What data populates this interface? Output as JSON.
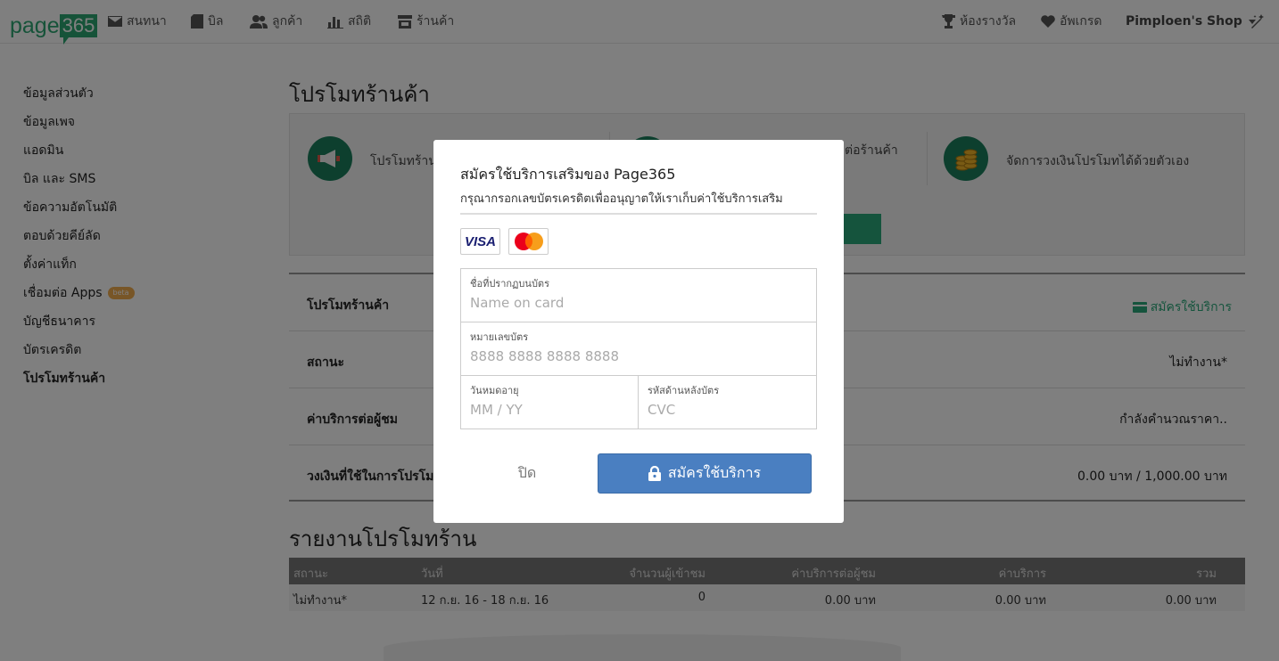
{
  "topnav": {
    "logo_text": "page",
    "logo_num": "365",
    "items": [
      {
        "label": "สนทนา",
        "icon": "envelope-icon"
      },
      {
        "label": "บิล",
        "icon": "bill-icon"
      },
      {
        "label": "ลูกค้า",
        "icon": "users-icon"
      },
      {
        "label": "สถิติ",
        "icon": "bar-chart-icon"
      },
      {
        "label": "ร้านค้า",
        "icon": "store-icon"
      }
    ],
    "right": [
      {
        "label": "ห้องรางวัล",
        "icon": "trophy-icon"
      },
      {
        "label": "อัพเกรด",
        "icon": "heart-icon"
      }
    ],
    "shop_name": "Pimploen's Shop"
  },
  "sidebar": {
    "items": [
      {
        "label": "ข้อมูลส่วนตัว"
      },
      {
        "label": "ข้อมูลเพจ"
      },
      {
        "label": "แอดมิน"
      },
      {
        "label": "บิล และ SMS"
      },
      {
        "label": "ข้อความอัตโนมัติ"
      },
      {
        "label": "ตอบด้วยคีย์ลัด"
      },
      {
        "label": "ตั้งค่าแท็ก"
      },
      {
        "label": "เชื่อมต่อ Apps",
        "badge": "beta"
      },
      {
        "label": "บัญชีธนาคาร"
      },
      {
        "label": "บัตรเครดิต"
      },
      {
        "label": "โปรโมทร้านค้า",
        "active": true
      }
    ]
  },
  "main": {
    "title": "โปรโมทร้านค้า",
    "features": [
      {
        "text": "โปรโมทร้านค้",
        "icon": "megaphone-icon"
      },
      {
        "text": "ต่อร้านค้า",
        "icon": "chart-icon"
      },
      {
        "text": "จัดการวงเงินโปรโมทได้ด้วยตัวเอง",
        "icon": "coins-icon"
      }
    ],
    "info_rows": [
      {
        "label": "โปรโมทร้านค้า",
        "link": "สมัครใช้บริการ"
      },
      {
        "label": "สถานะ",
        "value": "ไม่ทำงาน*"
      },
      {
        "label": "ค่าบริการต่อผู้ชม",
        "value": "กำลังคำนวณราคา.."
      },
      {
        "label": "วงเงินที่ใช้ในการโปรโมท",
        "value": "0.00 บาท / 1,000.00 บาท"
      }
    ],
    "report": {
      "title": "รายงานโปรโมทร้าน",
      "headers": [
        "สถานะ",
        "วันที่",
        "จำนวนผู้เข้าชม",
        "ค่าบริการต่อผู้ชม",
        "ค่าบริการ",
        "รวม"
      ],
      "rows": [
        [
          "ไม่ทำงาน*",
          "12 ก.ย. 16 - 18 ก.ย. 16",
          "0",
          "0.00 บาท",
          "0.00 บาท",
          "0.00 บาท"
        ]
      ]
    }
  },
  "modal": {
    "title": "สมัครใช้บริการเสริมของ Page365",
    "subtitle": "กรุณากรอกเลขบัตรเครดิตเพื่ออนุญาตให้เราเก็บค่าใช้บริการเสริม",
    "card_logos": [
      "VISA",
      "MasterCard"
    ],
    "fields": {
      "name": {
        "label": "ชื่อที่ปรากฏบนบัตร",
        "placeholder": "Name on card",
        "value": ""
      },
      "number": {
        "label": "หมายเลขบัตร",
        "placeholder": "8888 8888 8888 8888",
        "value": ""
      },
      "expiry": {
        "label": "วันหมดอายุ",
        "placeholder": "MM / YY",
        "value": ""
      },
      "cvc": {
        "label": "รหัสด้านหลังบัตร",
        "placeholder": "CVC",
        "value": ""
      }
    },
    "close_label": "ปิด",
    "submit_label": "สมัครใช้บริการ"
  },
  "colors": {
    "brand_green": "#2da772",
    "primary_blue": "#4a7fc1",
    "overlay": "rgba(0,0,0,0.5)"
  }
}
